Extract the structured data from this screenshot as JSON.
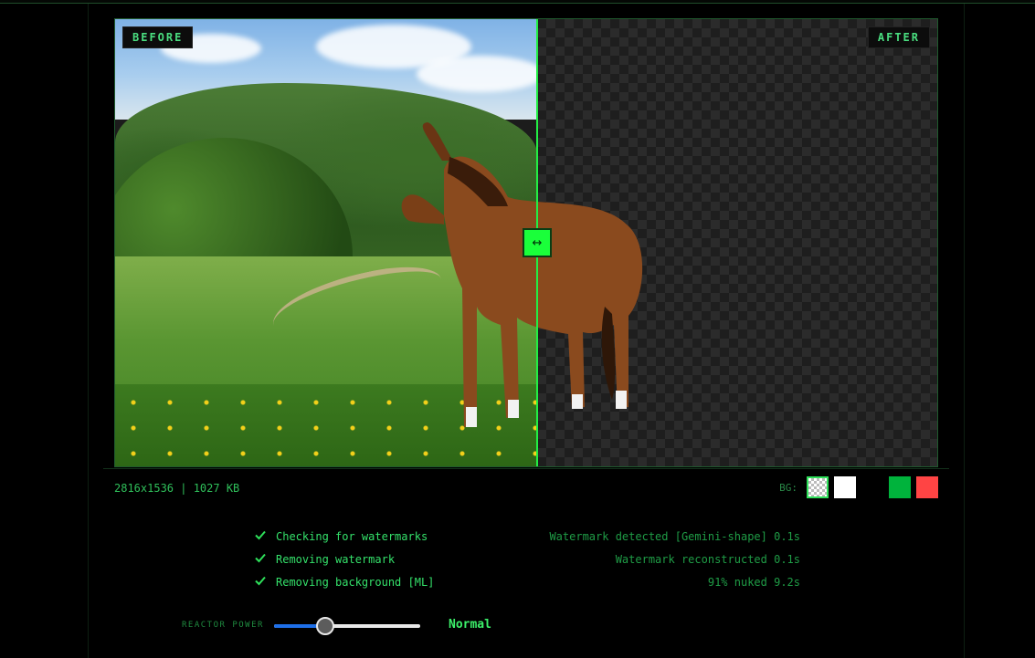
{
  "compare": {
    "before_label": "BEFORE",
    "after_label": "AFTER",
    "split_position_percent": 51,
    "handle_glyph": "↔"
  },
  "info": {
    "dimensions": "2816x1536 | 1027 KB"
  },
  "bg_picker": {
    "label": "BG:",
    "options": [
      {
        "name": "transparent",
        "color": "checker",
        "selected": true
      },
      {
        "name": "white",
        "color": "#ffffff"
      },
      {
        "name": "black",
        "color": "#000000"
      },
      {
        "name": "green",
        "color": "#00b33c"
      },
      {
        "name": "red",
        "color": "#ff4444"
      }
    ]
  },
  "steps": [
    {
      "icon": "check-icon",
      "label": "Checking for watermarks",
      "result": "Watermark detected [Gemini-shape] 0.1s"
    },
    {
      "icon": "check-icon",
      "label": "Removing watermark",
      "result": "Watermark reconstructed 0.1s"
    },
    {
      "icon": "check-icon",
      "label": "Removing background [ML]",
      "result": "91% nuked 9.2s"
    }
  ],
  "reactor": {
    "label": "REACTOR POWER",
    "value_text": "Normal",
    "level": 0.35
  },
  "colors": {
    "accent": "#22ee44",
    "text_green": "#34e06a",
    "dim_green": "#1f9c46",
    "slider_fill": "#1e6fe8"
  }
}
